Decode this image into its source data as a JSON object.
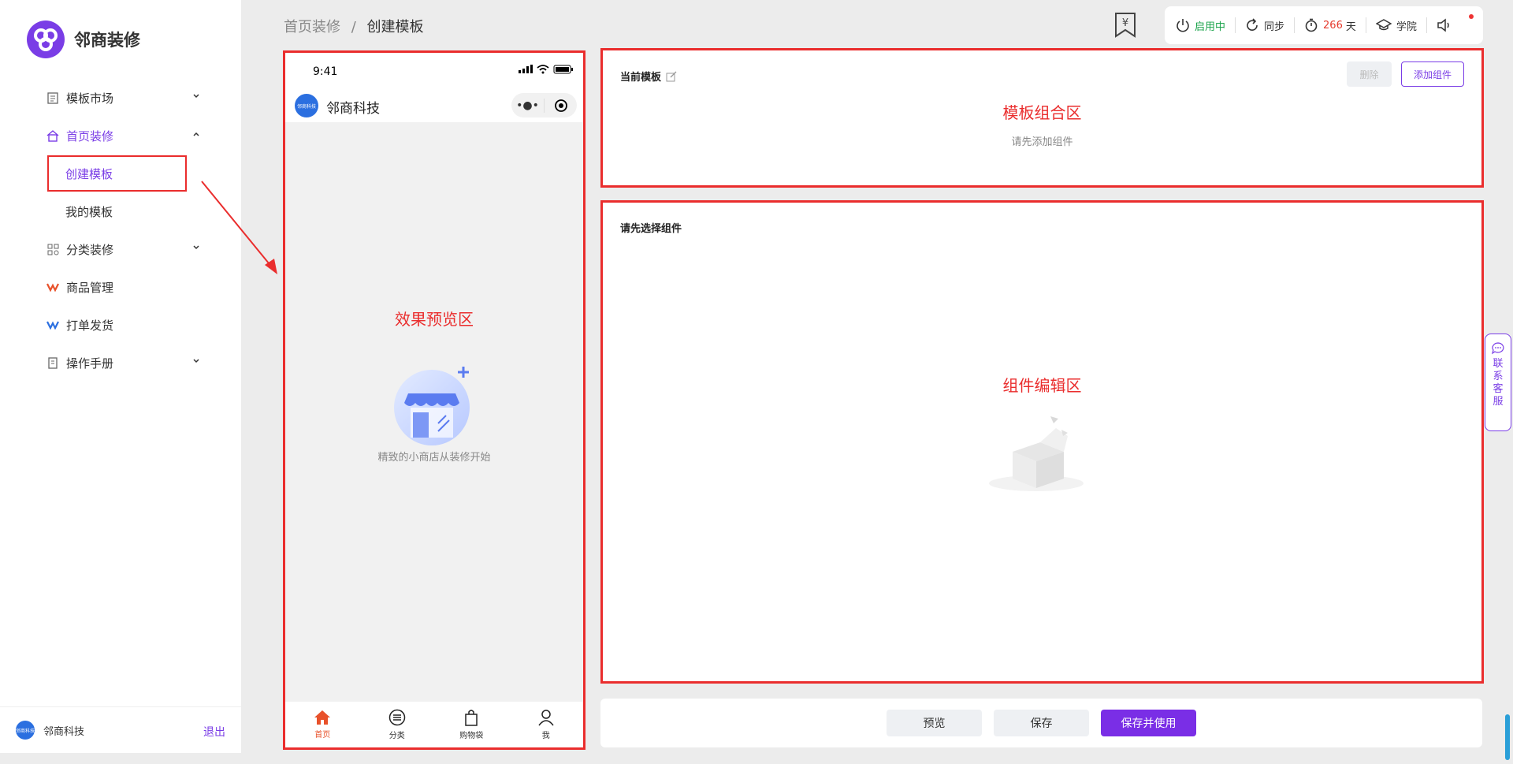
{
  "brand": {
    "name": "邻商装修"
  },
  "sidebar": {
    "items": [
      {
        "label": "模板市场",
        "icon": "template-icon",
        "expandable": true,
        "expanded": false
      },
      {
        "label": "首页装修",
        "icon": "home-icon",
        "expandable": true,
        "expanded": true,
        "active": true
      },
      {
        "label": "分类装修",
        "icon": "category-icon",
        "expandable": true,
        "expanded": false
      },
      {
        "label": "商品管理",
        "icon": "goods-icon",
        "expandable": false
      },
      {
        "label": "打单发货",
        "icon": "shipping-icon",
        "expandable": false
      },
      {
        "label": "操作手册",
        "icon": "manual-icon",
        "expandable": true,
        "expanded": false
      }
    ],
    "sub_items": [
      {
        "label": "创建模板",
        "active": true
      },
      {
        "label": "我的模板",
        "active": false
      }
    ],
    "footer": {
      "avatar_text": "邻商科技",
      "name": "邻商科技",
      "logout": "退出"
    }
  },
  "breadcrumb": {
    "parent": "首页装修",
    "separator": "/",
    "current": "创建模板"
  },
  "topbar": {
    "status": "启用中",
    "sync": "同步",
    "days_value": "266",
    "days_unit": "天",
    "academy": "学院"
  },
  "phone": {
    "time": "9:41",
    "app_logo_text": "邻商科技",
    "app_name": "邻商科技",
    "preview_label": "效果预览区",
    "empty_text": "精致的小商店从装修开始",
    "tabs": [
      {
        "label": "首页",
        "icon": "home-icon",
        "active": true
      },
      {
        "label": "分类",
        "icon": "list-icon",
        "active": false
      },
      {
        "label": "购物袋",
        "icon": "bag-icon",
        "active": false
      },
      {
        "label": "我",
        "icon": "user-icon",
        "active": false
      }
    ]
  },
  "template_panel": {
    "title": "当前模板",
    "delete_label": "删除",
    "add_label": "添加组件",
    "zone_label": "模板组合区",
    "hint": "请先添加组件"
  },
  "editor_panel": {
    "title": "请先选择组件",
    "zone_label": "组件编辑区"
  },
  "actions": {
    "preview": "预览",
    "save": "保存",
    "save_use": "保存并使用"
  },
  "customer_service": {
    "label": "联系客服"
  },
  "colors": {
    "accent": "#7a3de6",
    "annotation": "#ea2d2d",
    "active_tab": "#e8512a",
    "status_green": "#1aa34a"
  }
}
